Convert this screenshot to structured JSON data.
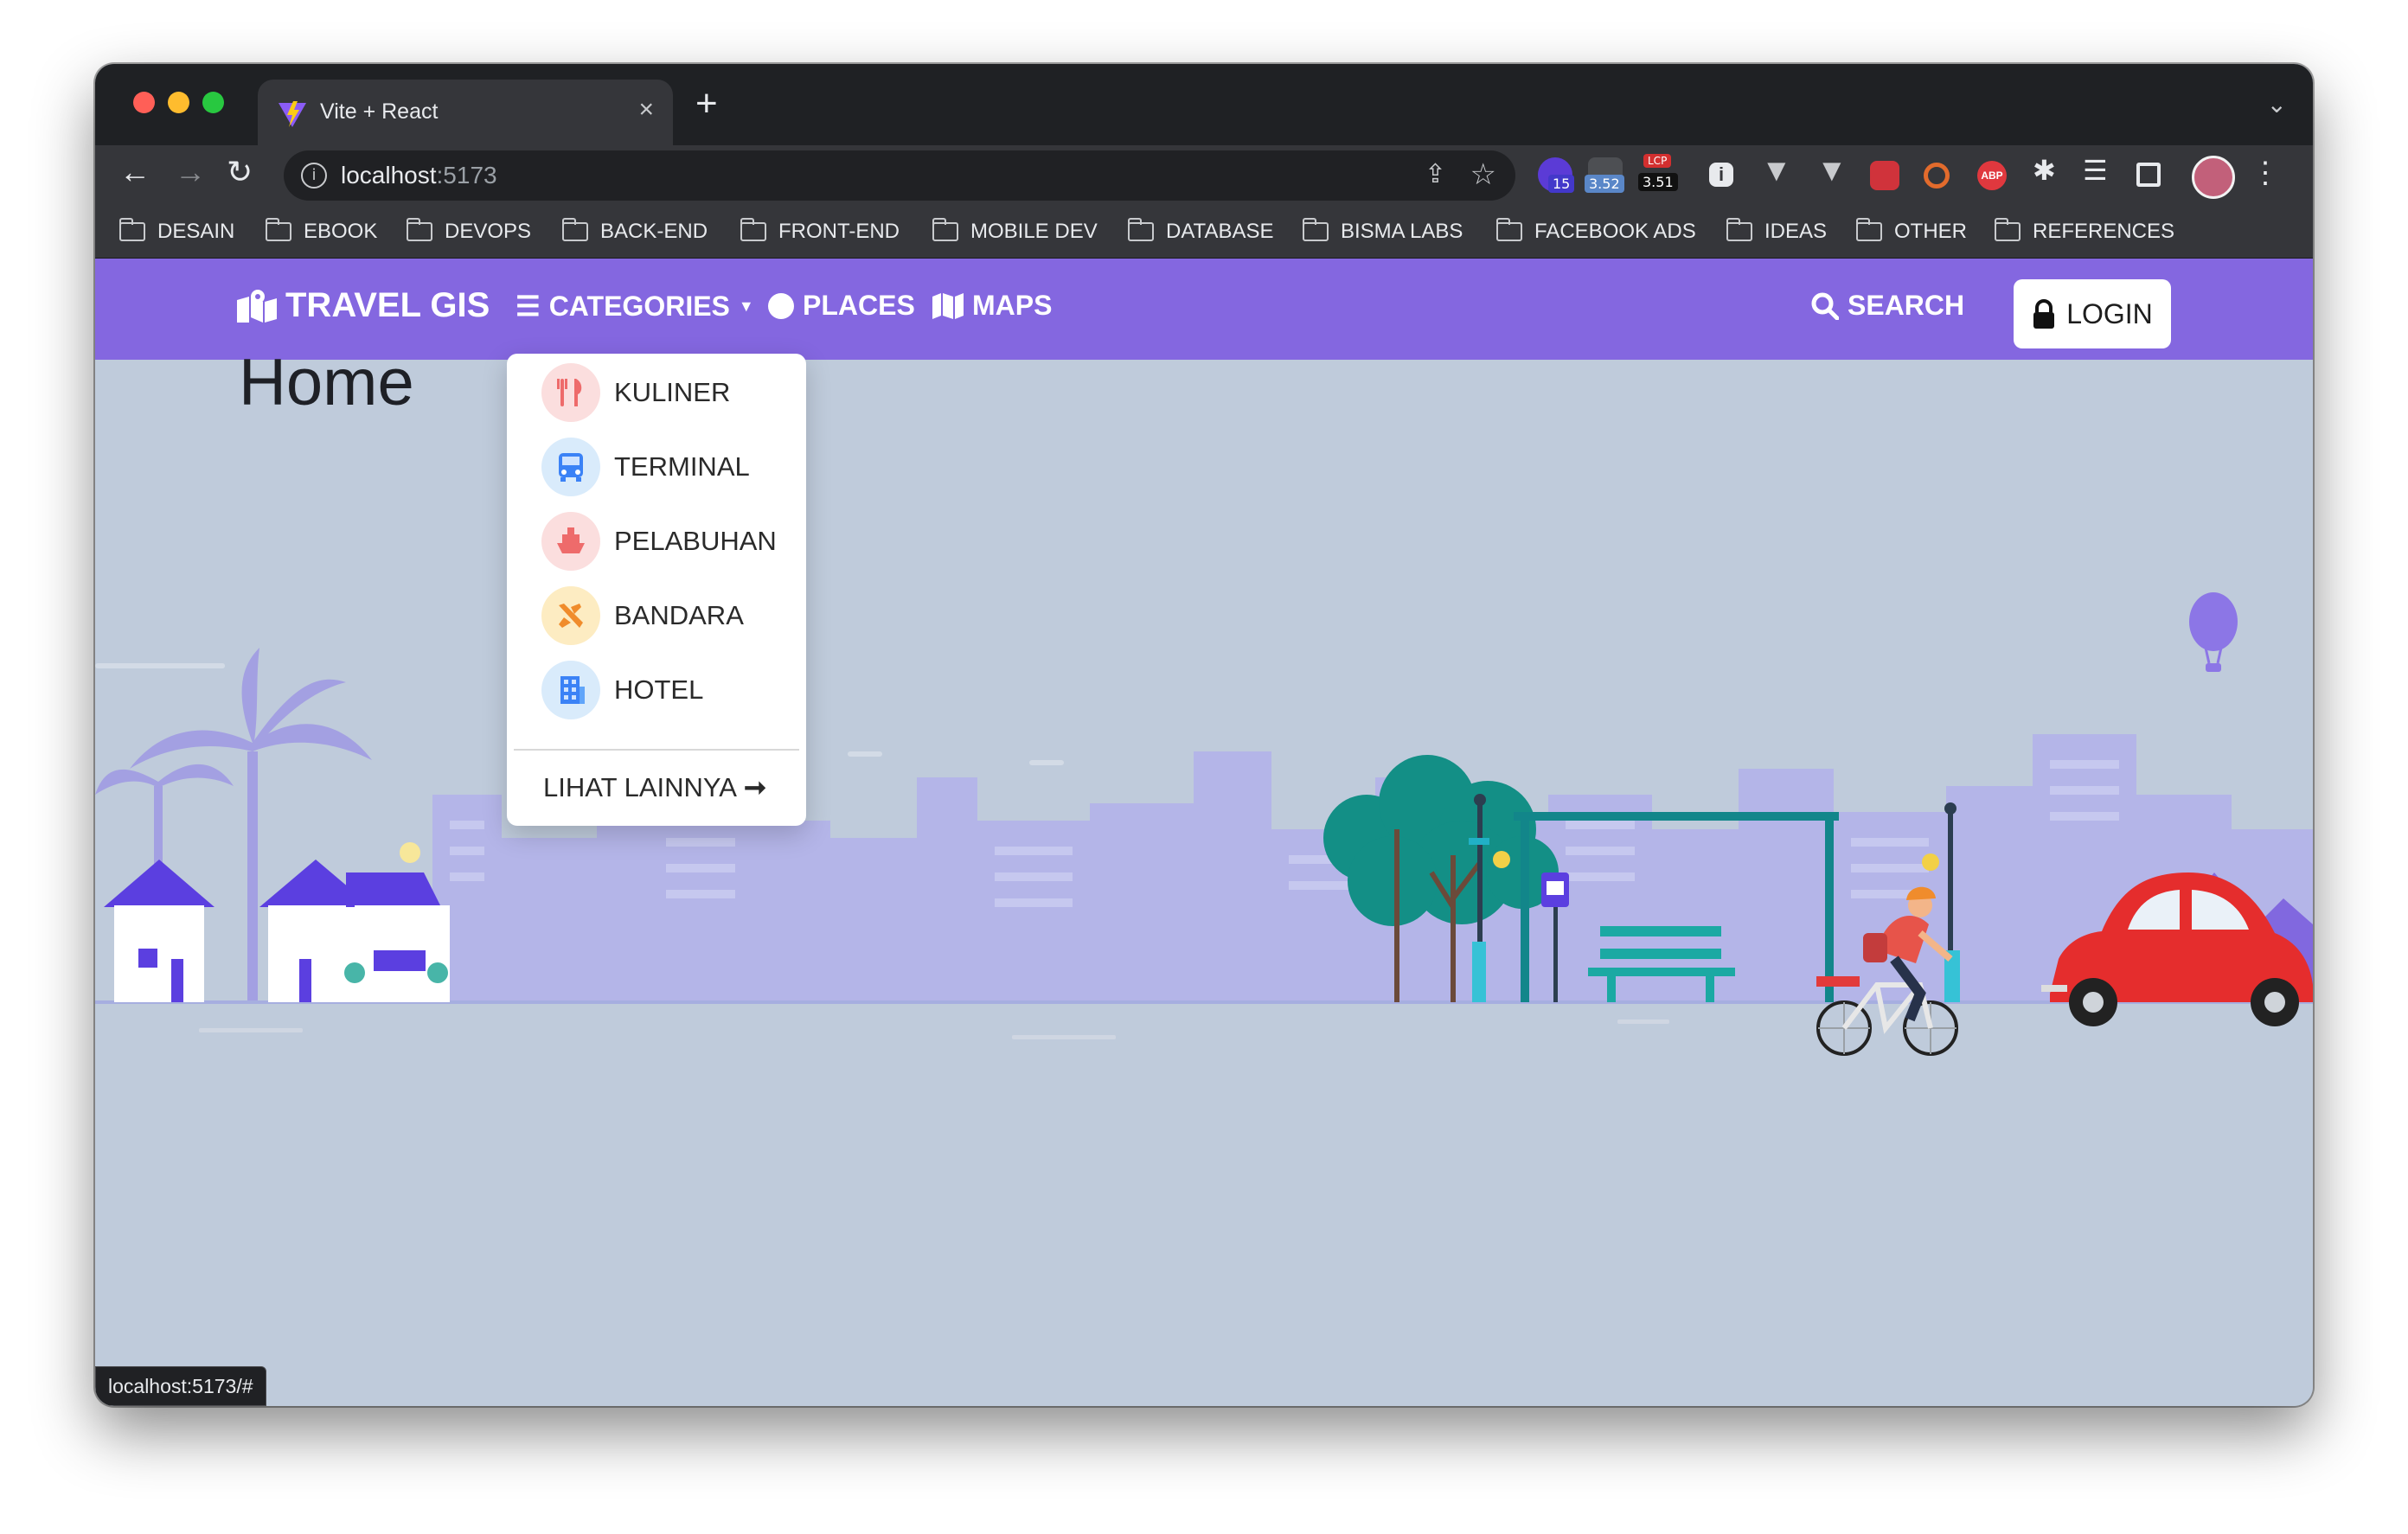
{
  "browser": {
    "tab_title": "Vite + React",
    "url_host": "localhost",
    "url_port": ":5173",
    "status_link": "localhost:5173/#",
    "extensions": {
      "badge_1": "15",
      "badge_2": "3.52",
      "lcp_label": "LCP",
      "lcp_value": "3.51",
      "abp_label": "ABP"
    }
  },
  "bookmarks": [
    "DESAIN",
    "EBOOK",
    "DEVOPS",
    "BACK-END",
    "FRONT-END",
    "MOBILE DEV",
    "DATABASE",
    "BISMA LABS",
    "FACEBOOK ADS",
    "IDEAS",
    "OTHER",
    "REFERENCES"
  ],
  "navbar": {
    "brand": "TRAVEL GIS",
    "categories": "CATEGORIES",
    "places": "PLACES",
    "maps": "MAPS",
    "search": "SEARCH",
    "login": "LOGIN"
  },
  "page": {
    "title": "Home"
  },
  "dropdown": {
    "items": [
      {
        "label": "KULINER",
        "icon": "utensils-icon"
      },
      {
        "label": "TERMINAL",
        "icon": "bus-icon"
      },
      {
        "label": "PELABUHAN",
        "icon": "ship-icon"
      },
      {
        "label": "BANDARA",
        "icon": "plane-icon"
      },
      {
        "label": "HOTEL",
        "icon": "hotel-icon"
      }
    ],
    "more": "LIHAT LAINNYA"
  },
  "colors": {
    "navbar": "#8467e0",
    "page_bg": "#bfcbdb",
    "city": "#aaa9e4",
    "car": "#e52d2d",
    "tree": "#138f86"
  }
}
